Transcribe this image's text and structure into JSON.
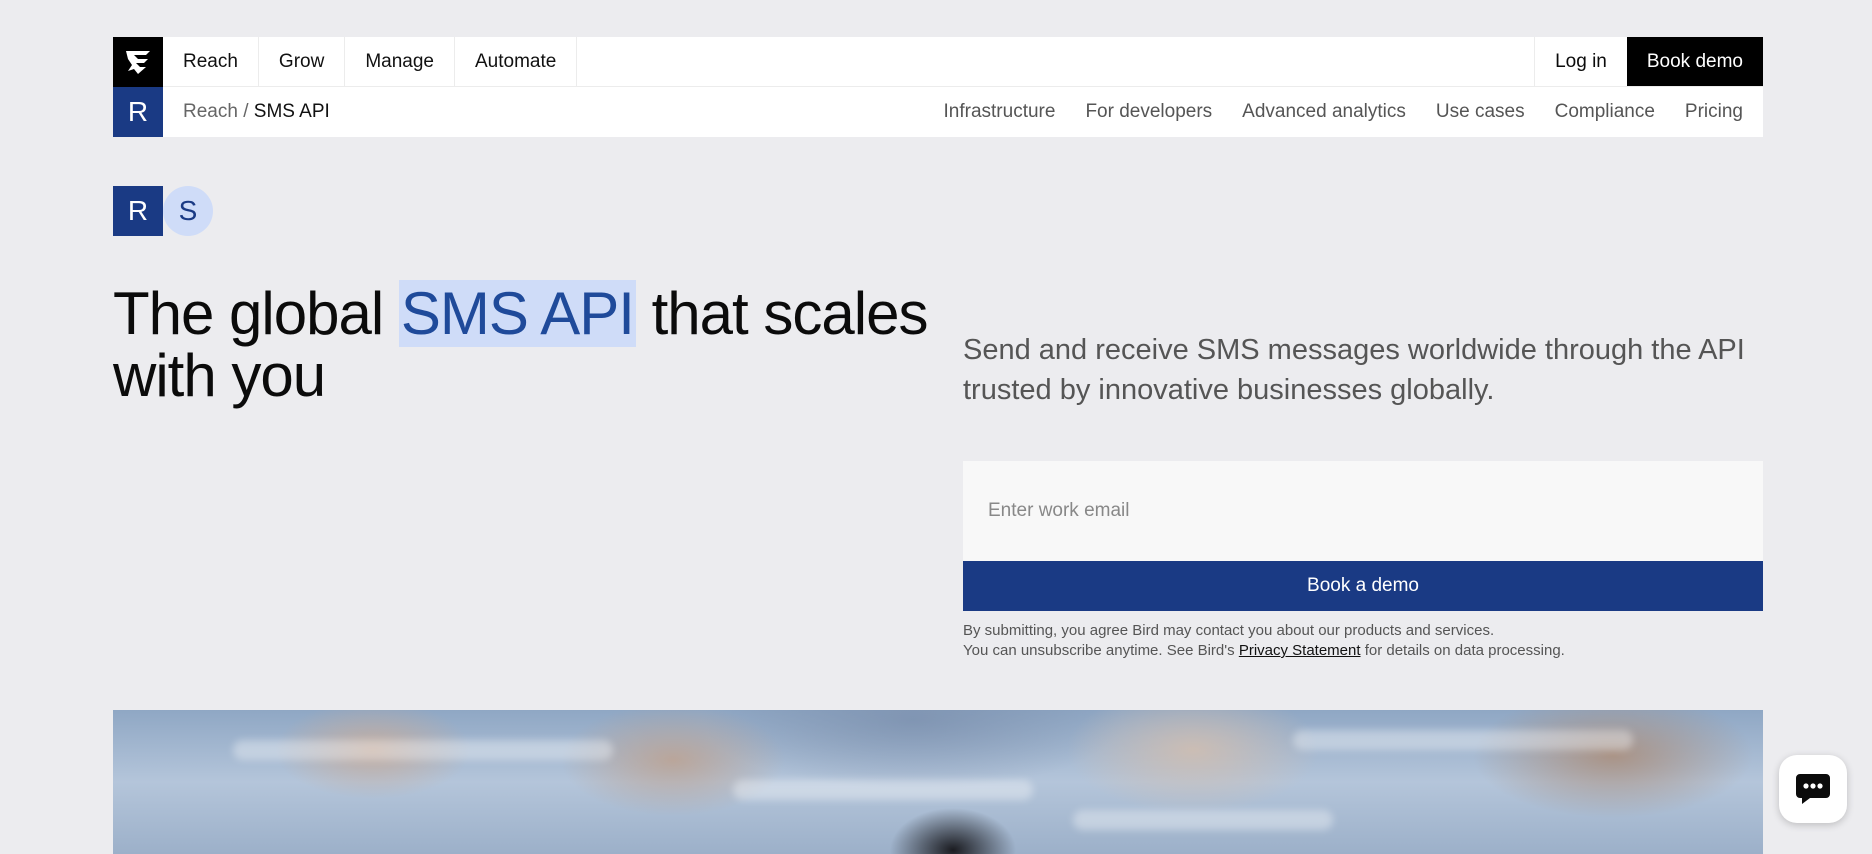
{
  "nav": {
    "items": [
      "Reach",
      "Grow",
      "Manage",
      "Automate"
    ],
    "login": "Log in",
    "book_demo": "Book demo"
  },
  "subnav": {
    "section_badge": "R",
    "breadcrumb_parent": "Reach /",
    "breadcrumb_current": "SMS API",
    "links": [
      "Infrastructure",
      "For developers",
      "Advanced analytics",
      "Use cases",
      "Compliance",
      "Pricing"
    ]
  },
  "avatars": {
    "r": "R",
    "s": "S"
  },
  "hero": {
    "headline_pre": "The global ",
    "headline_highlight": "SMS API",
    "headline_post": " that scales with you",
    "subtitle": "Send and receive SMS messages worldwide through the API trusted by innovative businesses globally."
  },
  "form": {
    "email_placeholder": "Enter work email",
    "submit_label": "Book a demo",
    "legal_line1": "By submitting, you agree Bird may contact you about our products and services.",
    "legal_line2_pre": "You can unsubscribe anytime. See Bird's",
    "legal_link": "Privacy Statement",
    "legal_line2_post": "for details on data processing."
  },
  "colors": {
    "brand_blue": "#1a3a84",
    "highlight_bg": "#cfdcf8",
    "page_bg": "#ececef"
  },
  "icons": {
    "logo": "bird-logo-icon",
    "chat": "chat-bubble-icon"
  }
}
